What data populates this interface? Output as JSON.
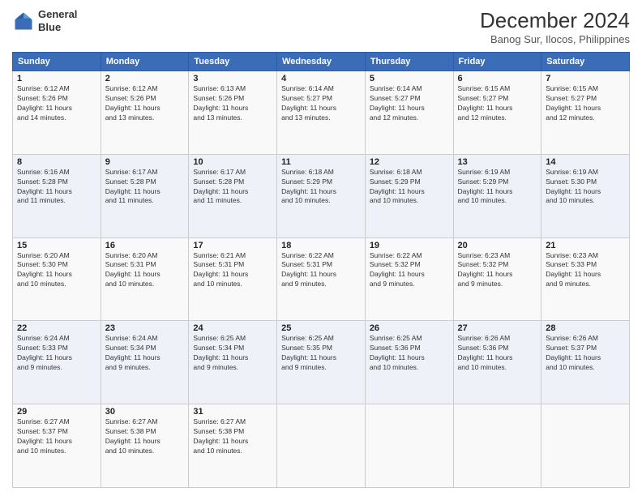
{
  "header": {
    "logo_line1": "General",
    "logo_line2": "Blue",
    "title": "December 2024",
    "subtitle": "Banog Sur, Ilocos, Philippines"
  },
  "days_of_week": [
    "Sunday",
    "Monday",
    "Tuesday",
    "Wednesday",
    "Thursday",
    "Friday",
    "Saturday"
  ],
  "weeks": [
    [
      {
        "day": "1",
        "info": "Sunrise: 6:12 AM\nSunset: 5:26 PM\nDaylight: 11 hours\nand 14 minutes."
      },
      {
        "day": "2",
        "info": "Sunrise: 6:12 AM\nSunset: 5:26 PM\nDaylight: 11 hours\nand 13 minutes."
      },
      {
        "day": "3",
        "info": "Sunrise: 6:13 AM\nSunset: 5:26 PM\nDaylight: 11 hours\nand 13 minutes."
      },
      {
        "day": "4",
        "info": "Sunrise: 6:14 AM\nSunset: 5:27 PM\nDaylight: 11 hours\nand 13 minutes."
      },
      {
        "day": "5",
        "info": "Sunrise: 6:14 AM\nSunset: 5:27 PM\nDaylight: 11 hours\nand 12 minutes."
      },
      {
        "day": "6",
        "info": "Sunrise: 6:15 AM\nSunset: 5:27 PM\nDaylight: 11 hours\nand 12 minutes."
      },
      {
        "day": "7",
        "info": "Sunrise: 6:15 AM\nSunset: 5:27 PM\nDaylight: 11 hours\nand 12 minutes."
      }
    ],
    [
      {
        "day": "8",
        "info": "Sunrise: 6:16 AM\nSunset: 5:28 PM\nDaylight: 11 hours\nand 11 minutes."
      },
      {
        "day": "9",
        "info": "Sunrise: 6:17 AM\nSunset: 5:28 PM\nDaylight: 11 hours\nand 11 minutes."
      },
      {
        "day": "10",
        "info": "Sunrise: 6:17 AM\nSunset: 5:28 PM\nDaylight: 11 hours\nand 11 minutes."
      },
      {
        "day": "11",
        "info": "Sunrise: 6:18 AM\nSunset: 5:29 PM\nDaylight: 11 hours\nand 10 minutes."
      },
      {
        "day": "12",
        "info": "Sunrise: 6:18 AM\nSunset: 5:29 PM\nDaylight: 11 hours\nand 10 minutes."
      },
      {
        "day": "13",
        "info": "Sunrise: 6:19 AM\nSunset: 5:29 PM\nDaylight: 11 hours\nand 10 minutes."
      },
      {
        "day": "14",
        "info": "Sunrise: 6:19 AM\nSunset: 5:30 PM\nDaylight: 11 hours\nand 10 minutes."
      }
    ],
    [
      {
        "day": "15",
        "info": "Sunrise: 6:20 AM\nSunset: 5:30 PM\nDaylight: 11 hours\nand 10 minutes."
      },
      {
        "day": "16",
        "info": "Sunrise: 6:20 AM\nSunset: 5:31 PM\nDaylight: 11 hours\nand 10 minutes."
      },
      {
        "day": "17",
        "info": "Sunrise: 6:21 AM\nSunset: 5:31 PM\nDaylight: 11 hours\nand 10 minutes."
      },
      {
        "day": "18",
        "info": "Sunrise: 6:22 AM\nSunset: 5:31 PM\nDaylight: 11 hours\nand 9 minutes."
      },
      {
        "day": "19",
        "info": "Sunrise: 6:22 AM\nSunset: 5:32 PM\nDaylight: 11 hours\nand 9 minutes."
      },
      {
        "day": "20",
        "info": "Sunrise: 6:23 AM\nSunset: 5:32 PM\nDaylight: 11 hours\nand 9 minutes."
      },
      {
        "day": "21",
        "info": "Sunrise: 6:23 AM\nSunset: 5:33 PM\nDaylight: 11 hours\nand 9 minutes."
      }
    ],
    [
      {
        "day": "22",
        "info": "Sunrise: 6:24 AM\nSunset: 5:33 PM\nDaylight: 11 hours\nand 9 minutes."
      },
      {
        "day": "23",
        "info": "Sunrise: 6:24 AM\nSunset: 5:34 PM\nDaylight: 11 hours\nand 9 minutes."
      },
      {
        "day": "24",
        "info": "Sunrise: 6:25 AM\nSunset: 5:34 PM\nDaylight: 11 hours\nand 9 minutes."
      },
      {
        "day": "25",
        "info": "Sunrise: 6:25 AM\nSunset: 5:35 PM\nDaylight: 11 hours\nand 9 minutes."
      },
      {
        "day": "26",
        "info": "Sunrise: 6:25 AM\nSunset: 5:36 PM\nDaylight: 11 hours\nand 10 minutes."
      },
      {
        "day": "27",
        "info": "Sunrise: 6:26 AM\nSunset: 5:36 PM\nDaylight: 11 hours\nand 10 minutes."
      },
      {
        "day": "28",
        "info": "Sunrise: 6:26 AM\nSunset: 5:37 PM\nDaylight: 11 hours\nand 10 minutes."
      }
    ],
    [
      {
        "day": "29",
        "info": "Sunrise: 6:27 AM\nSunset: 5:37 PM\nDaylight: 11 hours\nand 10 minutes."
      },
      {
        "day": "30",
        "info": "Sunrise: 6:27 AM\nSunset: 5:38 PM\nDaylight: 11 hours\nand 10 minutes."
      },
      {
        "day": "31",
        "info": "Sunrise: 6:27 AM\nSunset: 5:38 PM\nDaylight: 11 hours\nand 10 minutes."
      },
      {
        "day": "",
        "info": ""
      },
      {
        "day": "",
        "info": ""
      },
      {
        "day": "",
        "info": ""
      },
      {
        "day": "",
        "info": ""
      }
    ]
  ]
}
